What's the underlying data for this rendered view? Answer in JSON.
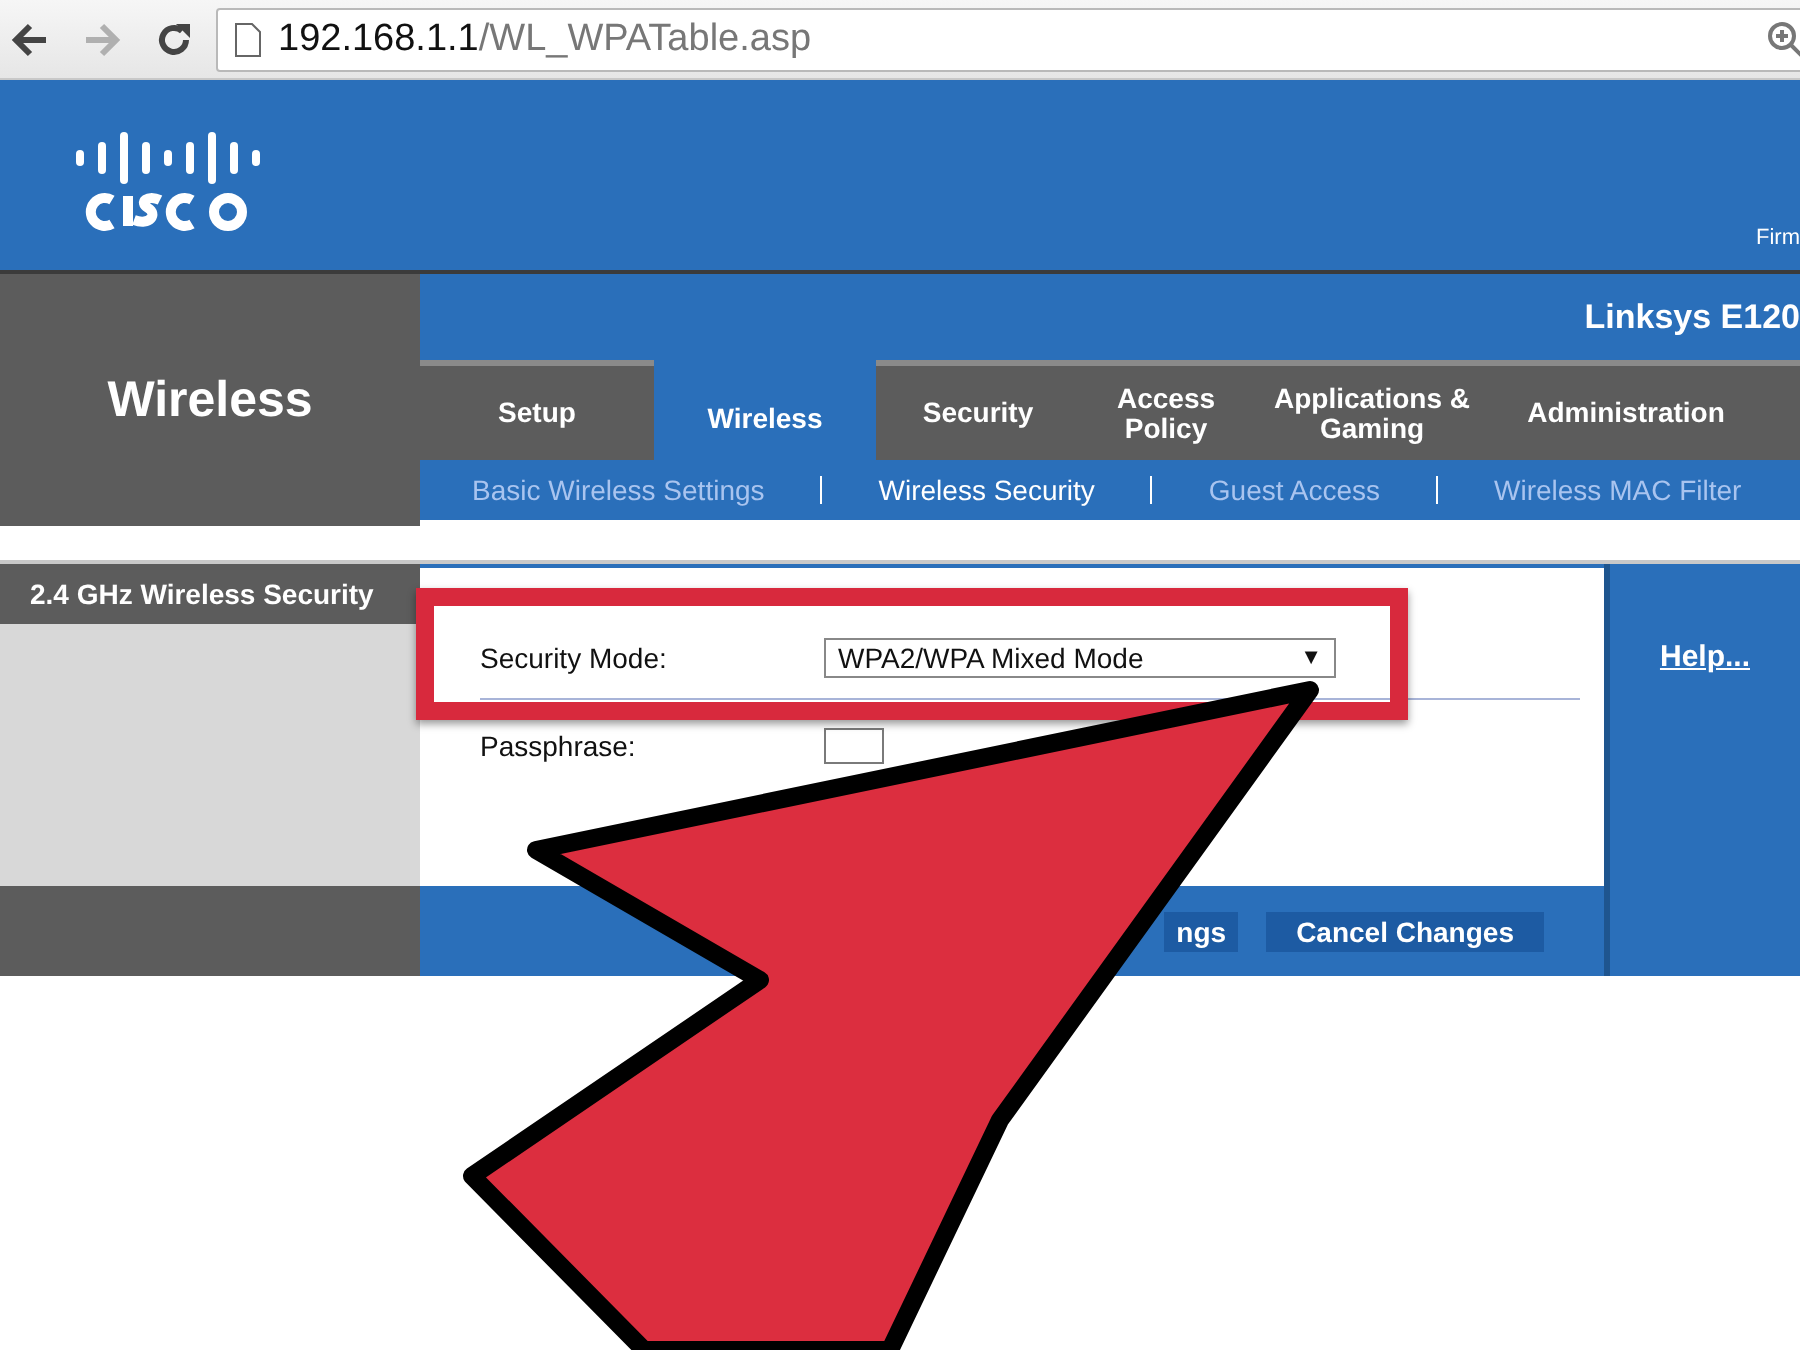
{
  "browser": {
    "nav_buttons": [
      {
        "kind": "back",
        "disabled": false
      },
      {
        "kind": "forward",
        "disabled": true
      },
      {
        "kind": "reload",
        "disabled": false
      }
    ],
    "address": {
      "host": "192.168.1.1",
      "path": "/WL_WPATable.asp"
    }
  },
  "header": {
    "firmware_label": "Firm"
  },
  "section_title": "Wireless",
  "product_name": "Linksys E120",
  "tabs": [
    {
      "label": "Setup",
      "selected": false
    },
    {
      "label": "Wireless",
      "selected": true
    },
    {
      "label": "Security",
      "selected": false
    },
    {
      "label": "Access\nPolicy",
      "selected": false
    },
    {
      "label": "Applications &\nGaming",
      "selected": false
    },
    {
      "label": "Administration",
      "selected": false
    }
  ],
  "subtabs": [
    {
      "label": "Basic Wireless Settings",
      "selected": false
    },
    {
      "label": "Wireless Security",
      "selected": true
    },
    {
      "label": "Guest Access",
      "selected": false
    },
    {
      "label": "Wireless MAC Filter",
      "selected": false
    }
  ],
  "sidebar_heading": "2.4 GHz Wireless Security",
  "form": {
    "security_mode_label": "Security Mode:",
    "security_mode_value": "WPA2/WPA Mixed Mode",
    "dropdown_arrow": "▼",
    "passphrase_label": "Passphrase:"
  },
  "buttons": [
    "ngs",
    "Cancel Changes"
  ],
  "help_link": "Help..."
}
